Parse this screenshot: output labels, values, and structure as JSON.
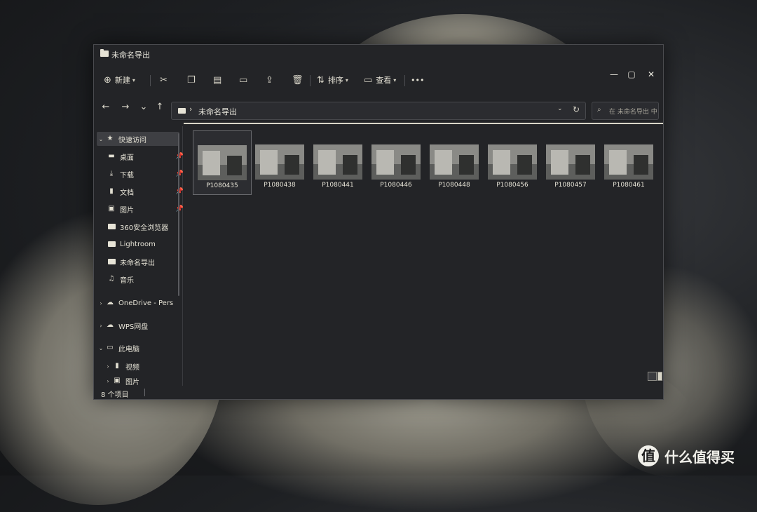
{
  "window": {
    "title": "未命名导出"
  },
  "window_controls": {
    "minimize": "—",
    "maximize": "▢",
    "close": "✕"
  },
  "toolbar": {
    "new_label": "新建",
    "sort_label": "排序",
    "view_label": "查看",
    "more_label": "•••",
    "icons": [
      "plus-circle-icon",
      "cut-icon",
      "copy-icon",
      "paste-icon",
      "rename-icon",
      "share-icon",
      "delete-icon",
      "sort-icon",
      "view-icon",
      "more-icon"
    ]
  },
  "nav": {
    "back": "←",
    "forward": "→",
    "recent": "⌄",
    "up": "↑"
  },
  "address": {
    "separator": "›",
    "path": "未命名导出",
    "dropdown": "⌄",
    "refresh": "↻"
  },
  "search": {
    "placeholder": "在 未命名导出 中..."
  },
  "sidebar": {
    "quick_access": "快速访问",
    "items": [
      {
        "label": "桌面",
        "icon": "desktop-icon",
        "pinned": true
      },
      {
        "label": "下载",
        "icon": "download-icon",
        "pinned": true
      },
      {
        "label": "文档",
        "icon": "document-icon",
        "pinned": true
      },
      {
        "label": "图片",
        "icon": "pictures-icon",
        "pinned": true
      },
      {
        "label": "360安全浏览器",
        "icon": "folder-icon",
        "pinned": false
      },
      {
        "label": "Lightroom",
        "icon": "folder-icon",
        "pinned": false
      },
      {
        "label": "未命名导出",
        "icon": "folder-icon",
        "pinned": false
      },
      {
        "label": "音乐",
        "icon": "music-icon",
        "pinned": false
      }
    ],
    "onedrive": "OneDrive - Pers",
    "wps": "WPS网盘",
    "this_pc": "此电脑",
    "videos": "视频",
    "pictures_partial": "图片"
  },
  "files": [
    {
      "name": "P1080435",
      "selected": true
    },
    {
      "name": "P1080438",
      "selected": false
    },
    {
      "name": "P1080441",
      "selected": false
    },
    {
      "name": "P1080446",
      "selected": false
    },
    {
      "name": "P1080448",
      "selected": false
    },
    {
      "name": "P1080456",
      "selected": false
    },
    {
      "name": "P1080457",
      "selected": false
    },
    {
      "name": "P1080461",
      "selected": false
    }
  ],
  "status": {
    "item_count": "8 个项目"
  },
  "watermark": {
    "logo": "值",
    "text": "什么值得买"
  }
}
